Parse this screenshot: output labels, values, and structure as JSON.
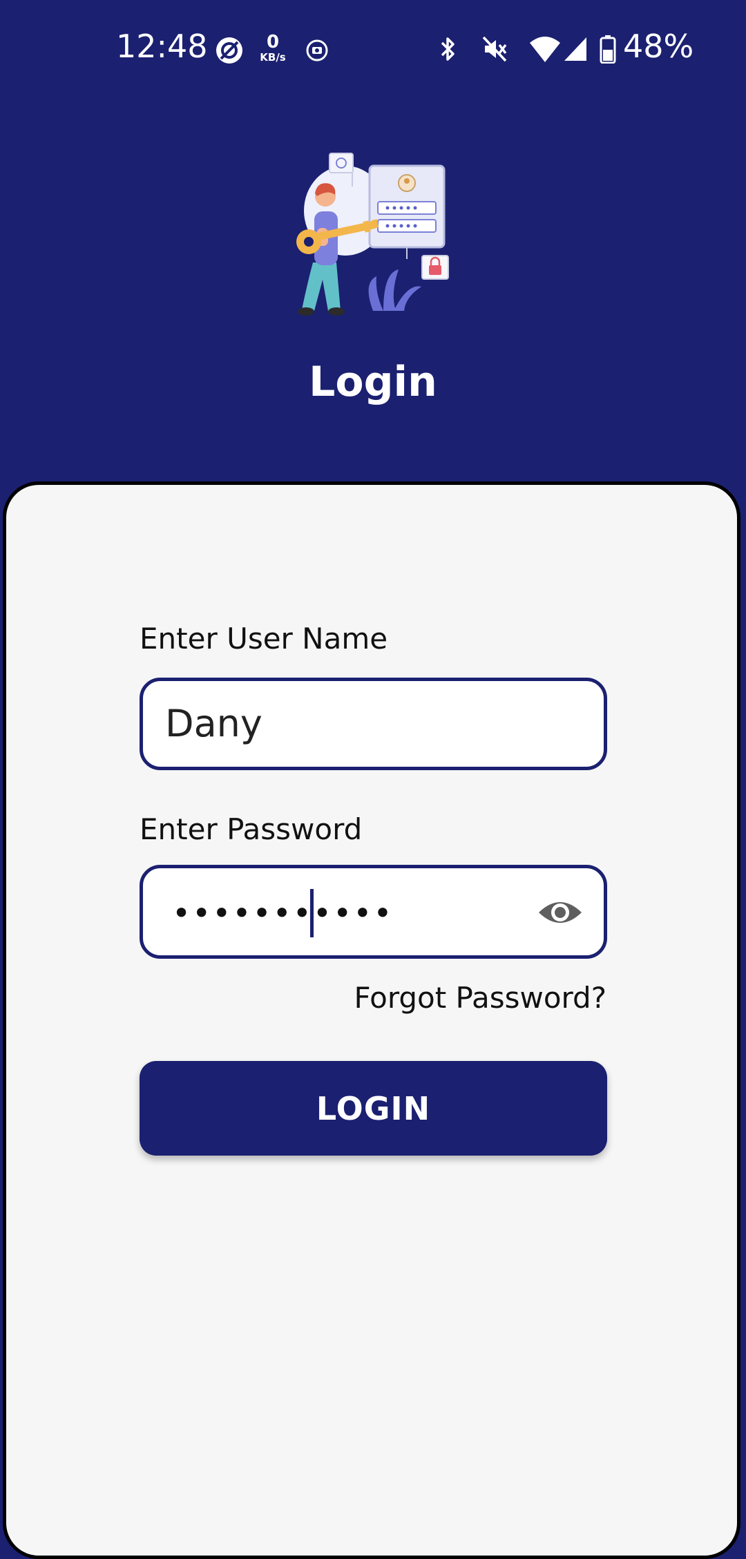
{
  "status_bar": {
    "time": "12:48",
    "net_speed_value": "0",
    "net_speed_unit": "KB/s",
    "battery_percent": "48%",
    "icons": [
      "data-saver-icon",
      "net-speed-icon",
      "screen-record-icon",
      "bluetooth-icon",
      "vibrate-off-icon",
      "wifi-icon",
      "cell-signal-icon",
      "battery-icon"
    ]
  },
  "header": {
    "title": "Login",
    "illustration": "login-key-illustration",
    "background_color": "#1b2070"
  },
  "form": {
    "username_label": "Enter User Name",
    "username_value": "Dany",
    "password_label": "Enter Password",
    "password_masked": "•••••••••••",
    "password_toggle_icon": "eye-icon",
    "forgot_password": "Forgot Password?",
    "login_button": "LOGIN"
  },
  "colors": {
    "primary": "#1b2070",
    "card_background": "#f6f6f6"
  }
}
